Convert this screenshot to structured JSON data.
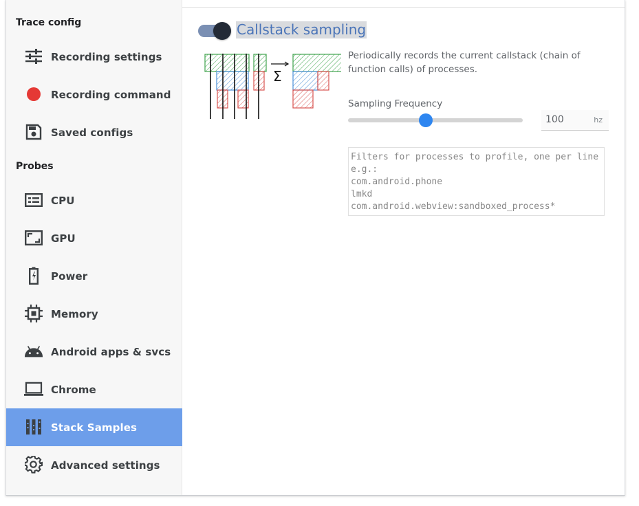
{
  "sidebar": {
    "sections": [
      {
        "title": "Trace config"
      },
      {
        "title": "Probes"
      }
    ],
    "items": [
      {
        "label": "Recording settings",
        "icon": "tune-icon"
      },
      {
        "label": "Recording command",
        "icon": "record-dot-icon",
        "icon_color": "#e53935"
      },
      {
        "label": "Saved configs",
        "icon": "save-icon"
      },
      {
        "label": "CPU",
        "icon": "cpu-icon"
      },
      {
        "label": "GPU",
        "icon": "gpu-icon"
      },
      {
        "label": "Power",
        "icon": "battery-icon"
      },
      {
        "label": "Memory",
        "icon": "memory-chip-icon"
      },
      {
        "label": "Android apps & svcs",
        "icon": "android-icon"
      },
      {
        "label": "Chrome",
        "icon": "laptop-icon"
      },
      {
        "label": "Stack Samples",
        "icon": "stack-samples-icon",
        "active": true
      },
      {
        "label": "Advanced settings",
        "icon": "gear-icon"
      }
    ],
    "active_color": "#6d9eea"
  },
  "probe": {
    "title": "Callstack sampling",
    "enabled": true,
    "description": "Periodically records the current callstack (chain of function calls) of processes.",
    "frequency": {
      "label": "Sampling Frequency",
      "value": "100",
      "unit": "hz",
      "slider_fraction": 0.445
    },
    "filters": {
      "placeholder": "Filters for processes to profile, one per line e.g.:\ncom.android.phone\nlmkd\ncom.android.webview:sandboxed_process*"
    }
  },
  "colors": {
    "accent": "#2e86f0",
    "title": "#4a74b8",
    "record": "#e53935"
  }
}
